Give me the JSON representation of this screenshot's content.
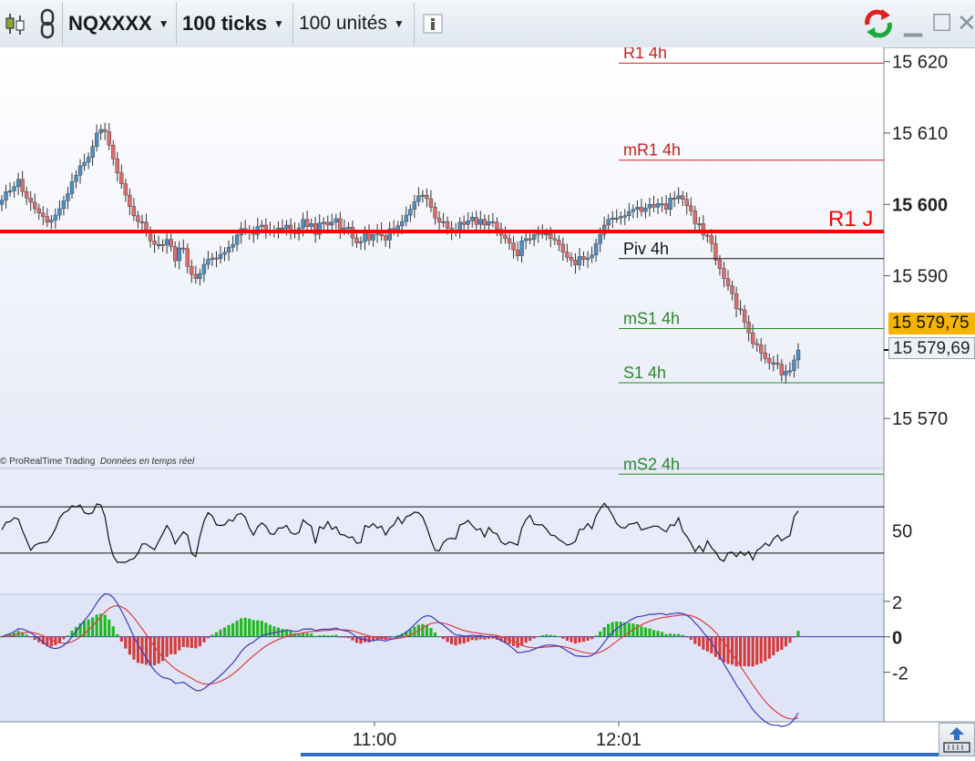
{
  "toolbar": {
    "symbol": "NQXXXX",
    "interval": "100 ticks",
    "units": "100 unités"
  },
  "credit": {
    "brand": "© ProRealTime Trading",
    "note": "Données en temps réel"
  },
  "price_tags": {
    "last": "15 579,75",
    "second": "15 579,69"
  },
  "colors": {
    "bull": "#4b8fc4",
    "bear": "#d96e6e",
    "resistance": "#c81e1e",
    "support": "#2a8a2a",
    "daily_r1": "#ff0000",
    "last_tag": "#f4b400"
  },
  "icons": [
    "candlestick-icon",
    "link-icon",
    "info-icon",
    "refresh-icon",
    "minimize-icon",
    "maximize-icon",
    "close-icon",
    "scroll-icon"
  ],
  "chart_data": [
    {
      "type": "candlestick",
      "ylim": [
        15563,
        15622
      ],
      "y_ticks": [
        15620,
        15610,
        15600,
        15590,
        15570
      ],
      "y_tick_labels": [
        "15 620",
        "15 610",
        "15 600",
        "15 590",
        "15 570"
      ],
      "x_tick_labels": [
        "11:00",
        "12:01"
      ],
      "levels": [
        {
          "label": "R1 4h",
          "value": 15619.8,
          "kind": "resistance"
        },
        {
          "label": "mR1 4h",
          "value": 15606.2,
          "kind": "resistance"
        },
        {
          "label": "Piv 4h",
          "value": 15592.4,
          "kind": "pivot"
        },
        {
          "label": "mS1 4h",
          "value": 15582.6,
          "kind": "support"
        },
        {
          "label": "S1 4h",
          "value": 15575.0,
          "kind": "support"
        },
        {
          "label": "mS2 4h",
          "value": 15562.2,
          "kind": "support"
        }
      ],
      "daily_level": {
        "label": "R1 J",
        "value": 15596.2
      },
      "close": [
        15600.6,
        15601.8,
        15601.9,
        15602.5,
        15603.5,
        15601.8,
        15600.9,
        15600.3,
        15599.4,
        15598.8,
        15598.3,
        15597.5,
        15597.8,
        15598.5,
        15599.4,
        15600.5,
        15601.5,
        15603.2,
        15604.1,
        15605.4,
        15605.9,
        15606.6,
        15608.1,
        15610.0,
        15610.5,
        15610.2,
        15608.3,
        15606.4,
        15604.4,
        15602.9,
        15601.3,
        15599.7,
        15598.4,
        15597.6,
        15597.5,
        15596.2,
        15594.9,
        15594.4,
        15594.4,
        15594.3,
        15595.1,
        15594.1,
        15592.1,
        15593.9,
        15593.8,
        15591.3,
        15590.2,
        15589.6,
        15590.3,
        15591.6,
        15592.3,
        15592.5,
        15592.4,
        15593.0,
        15593.3,
        15594.0,
        15594.4,
        15595.7,
        15596.6,
        15596.4,
        15596.0,
        15595.8,
        15596.9,
        15597.1,
        15596.4,
        15596.3,
        15596.4,
        15596.7,
        15596.6,
        15597.1,
        15596.3,
        15595.9,
        15596.7,
        15597.9,
        15596.9,
        15597.3,
        15595.8,
        15597.4,
        15597.5,
        15597.1,
        15597.5,
        15598.0,
        15596.4,
        15596.7,
        15596.8,
        15595.3,
        15594.6,
        15594.8,
        15596.0,
        15595.0,
        15595.8,
        15596.3,
        15595.6,
        15595.0,
        15596.6,
        15596.4,
        15597.0,
        15597.6,
        15598.5,
        15599.3,
        15600.4,
        15601.2,
        15601.3,
        15600.8,
        15599.6,
        15598.1,
        15597.5,
        15597.6,
        15596.7,
        15596.2,
        15596.2,
        15597.5,
        15597.2,
        15597.7,
        15598.2,
        15597.2,
        15597.9,
        15597.1,
        15597.6,
        15597.5,
        15596.5,
        15595.7,
        15595.2,
        15594.6,
        15593.6,
        15592.8,
        15594.9,
        15595.2,
        15595.1,
        15595.8,
        15596.0,
        15595.9,
        15595.9,
        15595.2,
        15595.0,
        15594.4,
        15593.3,
        15592.6,
        15592.2,
        15591.5,
        15592.7,
        15592.3,
        15592.5,
        15592.9,
        15594.5,
        15595.8,
        15597.1,
        15597.9,
        15598.1,
        15598.1,
        15598.3,
        15598.4,
        15599.0,
        15599.3,
        15599.6,
        15599.0,
        15599.5,
        15600.0,
        15599.6,
        15600.1,
        15600.1,
        15599.3,
        15600.9,
        15600.8,
        15601.2,
        15600.7,
        15599.8,
        15599.1,
        15597.3,
        15597.3,
        15595.7,
        15595.6,
        15594.5,
        15592.2,
        15591.0,
        15589.6,
        15588.6,
        15587.5,
        15585.4,
        15585.2,
        15583.5,
        15582.0,
        15580.5,
        15580.3,
        15579.2,
        15578.4,
        15577.8,
        15577.8,
        15577.6,
        15576.1,
        15576.6,
        15576.7,
        15578.2,
        15579.6
      ]
    },
    {
      "type": "line",
      "y_ticks": [
        50
      ],
      "y_tick_labels": [
        "50"
      ],
      "bands": [
        30,
        70
      ]
    },
    {
      "type": "histogram",
      "y_ticks": [
        2,
        0,
        -2
      ],
      "y_tick_labels": [
        "2",
        "0",
        "-2"
      ],
      "ylim": [
        -4.8,
        2.4
      ],
      "series": [
        {
          "kind": "macd",
          "color": "#3b3bbf"
        },
        {
          "kind": "signal",
          "color": "#e03c3c"
        },
        {
          "kind": "histogram"
        }
      ]
    }
  ]
}
